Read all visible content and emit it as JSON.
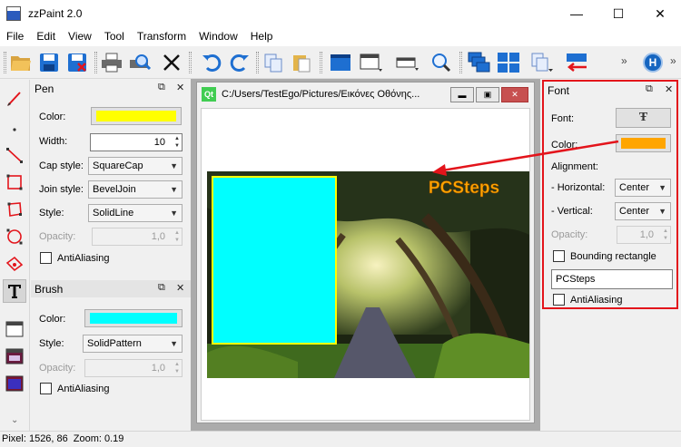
{
  "window": {
    "title": "zzPaint 2.0",
    "minimize": "—",
    "maximize": "☐",
    "close": "✕"
  },
  "menu": [
    "File",
    "Edit",
    "View",
    "Tool",
    "Transform",
    "Window",
    "Help"
  ],
  "toolbar": {
    "more_1": "»",
    "more_2": "»",
    "help_label": "H",
    "icons": [
      "open-folder-icon",
      "save-icon",
      "save-as-icon",
      "print-icon",
      "print-preview-icon",
      "cut-icon",
      "undo-icon",
      "redo-icon",
      "copy-icon",
      "paste-icon",
      "window-blue-icon",
      "window-dark-icon",
      "window-dropdown-icon",
      "zoom-icon",
      "cascade-icon",
      "tile-icon",
      "copy-dropdown-icon",
      "arrow-left-icon"
    ]
  },
  "pen": {
    "title": "Pen",
    "color_label": "Color:",
    "color": "#ffff00",
    "width_label": "Width:",
    "width_value": "10",
    "cap_label": "Cap style:",
    "cap_value": "SquareCap",
    "join_label": "Join style:",
    "join_value": "BevelJoin",
    "style_label": "Style:",
    "style_value": "SolidLine",
    "opacity_label": "Opacity:",
    "opacity_value": "1,0",
    "antialias_label": "AntiAliasing"
  },
  "brush": {
    "title": "Brush",
    "color_label": "Color:",
    "color": "#00ffff",
    "style_label": "Style:",
    "style_value": "SolidPattern",
    "opacity_label": "Opacity:",
    "opacity_value": "1,0",
    "antialias_label": "AntiAliasing"
  },
  "font_panel": {
    "title": "Font",
    "font_label": "Font:",
    "font_button_glyph": "Ŧ",
    "color_label": "Color:",
    "color": "#ffa500",
    "alignment_label": "Alignment:",
    "horizontal_label": "- Horizontal:",
    "horizontal_value": "Center",
    "vertical_label": "- Vertical:",
    "vertical_value": "Center",
    "opacity_label": "Opacity:",
    "opacity_value": "1,0",
    "bounding_label": "Bounding rectangle",
    "text_value": "PCSteps",
    "antialias_label": "AntiAliasing"
  },
  "document": {
    "path": "C:/Users/TestEgo/Pictures/Εικόνες Οθόνης...",
    "qt_label": "Qt",
    "overlay_text": "PCSteps",
    "overlay_color": "#ffa500",
    "rect_fill": "#00ffff",
    "rect_stroke": "#ffff00",
    "annotation_color": "#e3141b"
  },
  "status": {
    "pixel": "Pixel: 1526, 86",
    "zoom": "Zoom: 0.19"
  },
  "dock_controls": {
    "float": "⧉",
    "close": "✕"
  },
  "toolbox_more": "⌄"
}
